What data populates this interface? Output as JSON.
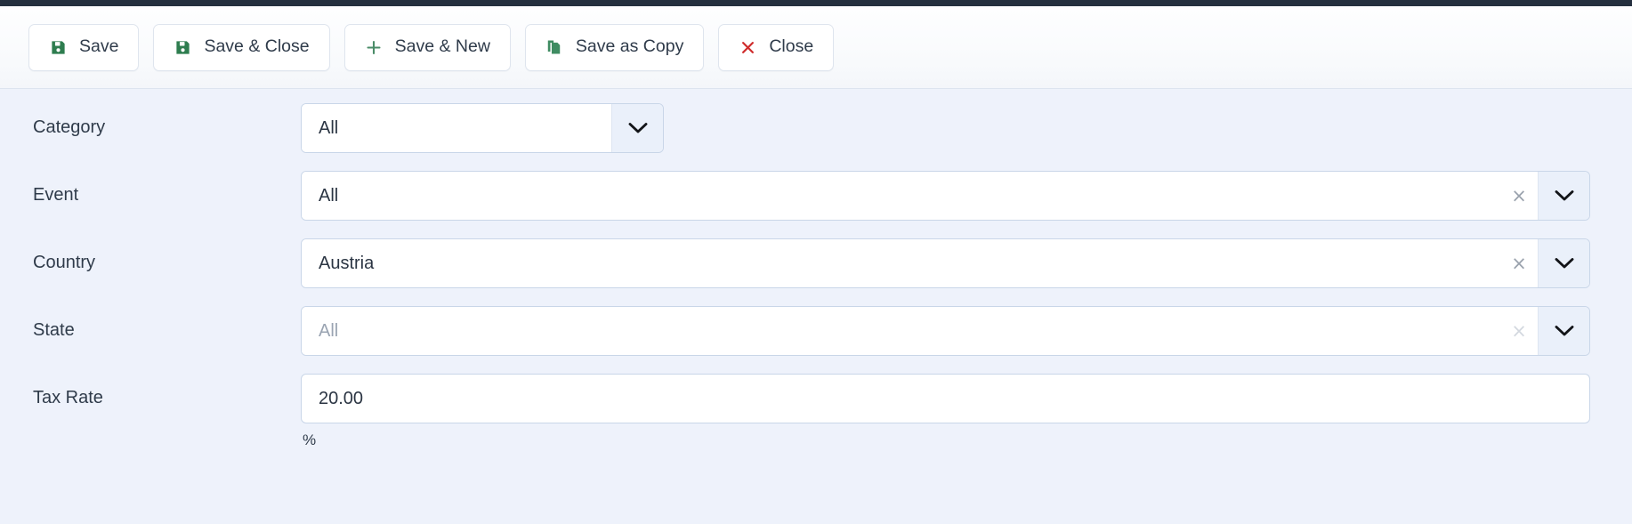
{
  "toolbar": {
    "buttons": [
      {
        "label": "Save",
        "icon": "floppy-disk-icon",
        "icon_color": "#2e7d4f"
      },
      {
        "label": "Save & Close",
        "icon": "floppy-disk-icon",
        "icon_color": "#2e7d4f"
      },
      {
        "label": "Save & New",
        "icon": "plus-icon",
        "icon_color": "#4a8c68"
      },
      {
        "label": "Save as Copy",
        "icon": "copy-icon",
        "icon_color": "#3f8c62"
      },
      {
        "label": "Close",
        "icon": "x-mark-icon",
        "icon_color": "#cf2d2d"
      }
    ]
  },
  "form": {
    "fields": [
      {
        "label": "Category",
        "type": "select",
        "width": "narrow",
        "value": "All",
        "is_placeholder": false,
        "has_clear": false,
        "clear_icon": "close-icon",
        "caret_icon": "chevron-down-icon"
      },
      {
        "label": "Event",
        "type": "select",
        "width": "wide",
        "value": "All",
        "is_placeholder": false,
        "has_clear": true,
        "clear_faded": false,
        "clear_icon": "close-icon",
        "caret_icon": "chevron-down-icon"
      },
      {
        "label": "Country",
        "type": "select",
        "width": "wide",
        "value": "Austria",
        "is_placeholder": false,
        "has_clear": true,
        "clear_faded": false,
        "clear_icon": "close-icon",
        "caret_icon": "chevron-down-icon"
      },
      {
        "label": "State",
        "type": "select",
        "width": "wide",
        "value": "All",
        "is_placeholder": true,
        "has_clear": true,
        "clear_faded": true,
        "clear_icon": "close-icon",
        "caret_icon": "chevron-down-icon"
      },
      {
        "label": "Tax Rate",
        "type": "text",
        "value": "20.00",
        "suffix": "%"
      }
    ]
  },
  "colors": {
    "page_background": "#eef2fb",
    "toolbar_background": "#f8fafc",
    "top_strip": "#25303f",
    "field_border": "#c9d6e8",
    "caret_background": "#eaf0fa",
    "text": "#2f3b4a",
    "placeholder_text": "#9aa4b2"
  },
  "clear_glyph": "×",
  "labels": {
    "category": "Category",
    "event": "Event",
    "country": "Country",
    "state": "State",
    "tax_rate": "Tax Rate",
    "percent": "%"
  }
}
